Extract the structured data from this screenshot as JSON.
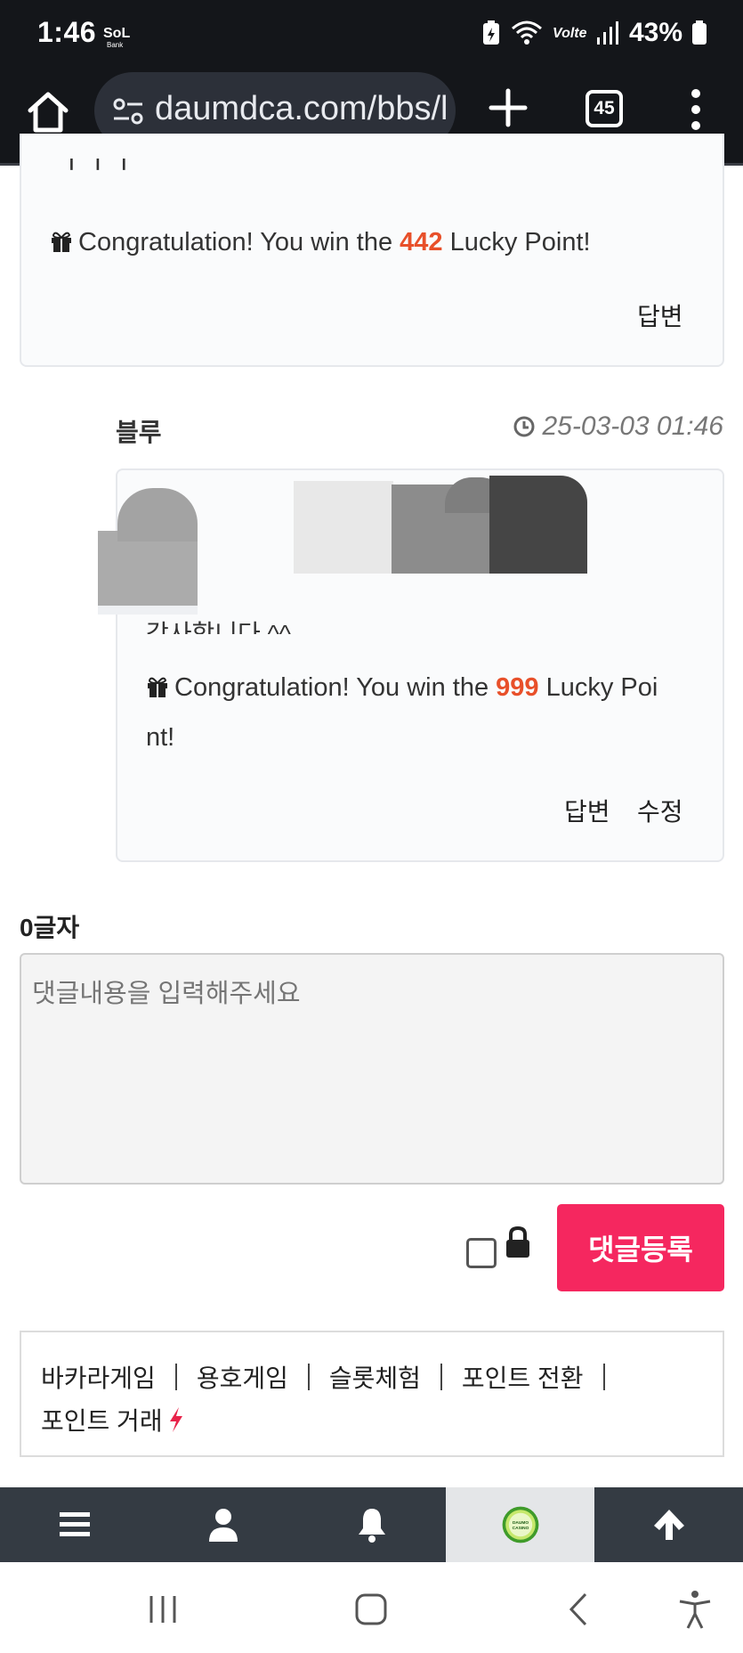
{
  "status_bar": {
    "time": "1:46",
    "carrier_logo_text": "SoL",
    "battery_percent": "43%",
    "network_label": "VoLTE"
  },
  "browser": {
    "url": "daumdca.com/bbs/l",
    "tab_count": "45"
  },
  "comments": [
    {
      "partial_text": "ㄱㄱㄱ",
      "lucky_prefix": "Congratulation! You win the ",
      "lucky_points": "442",
      "lucky_suffix": " Lucky Point!",
      "reply_label": "답변"
    },
    {
      "author": "블루",
      "timestamp": "25-03-03 01:46",
      "partial_text": "감사합니다 ^^",
      "lucky_prefix": "Congratulation! You win the ",
      "lucky_points": "999",
      "lucky_suffix": " Lucky Poi",
      "lucky_wrap": "nt!",
      "reply_label": "답변",
      "edit_label": "수정"
    }
  ],
  "comment_form": {
    "char_count": "0글자",
    "placeholder": "댓글내용을 입력해주세요",
    "submit_label": "댓글등록"
  },
  "footer_links": [
    "바카라게임",
    "용호게임",
    "슬롯체험",
    "포인트 전환",
    "포인트 거래"
  ],
  "site_nav": {
    "casino_logo_text": "DAUMO CASINO",
    "items": [
      "menu-icon",
      "user-icon",
      "bell-icon",
      "casino-logo",
      "arrow-up-icon"
    ]
  },
  "colors": {
    "accent": "#f5275f",
    "points": "#e8502a",
    "status_bg": "#14161a",
    "nav_bg": "#343b43"
  }
}
